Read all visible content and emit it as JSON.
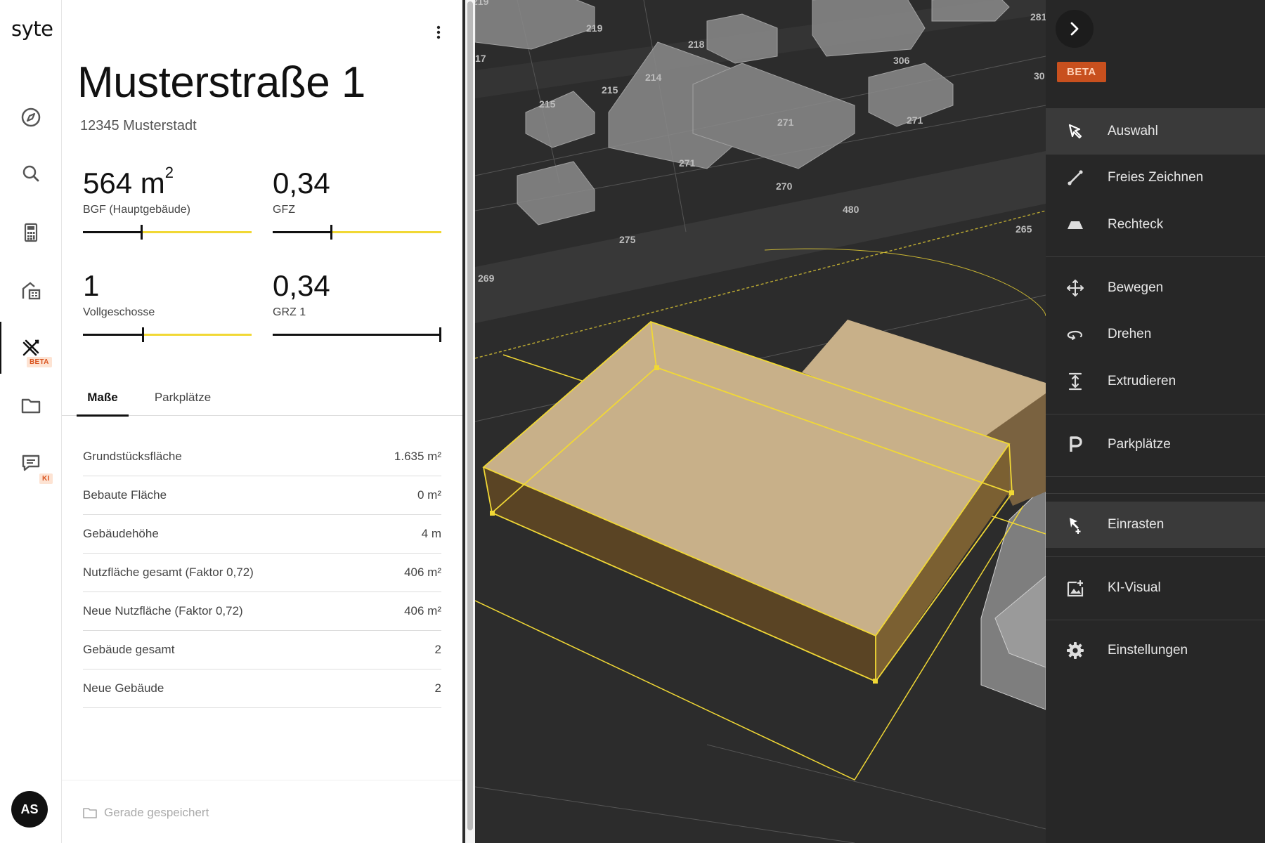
{
  "app": {
    "logo": "syte",
    "user_initials": "AS"
  },
  "rail": {
    "items": [
      {
        "name": "explore",
        "icon": "compass-icon"
      },
      {
        "name": "search",
        "icon": "search-icon"
      },
      {
        "name": "calculator",
        "icon": "calculator-icon"
      },
      {
        "name": "buildings",
        "icon": "building-icon"
      },
      {
        "name": "design",
        "icon": "drafting-tools-icon",
        "badge": "BETA",
        "active": true
      },
      {
        "name": "projects",
        "icon": "folder-icon"
      },
      {
        "name": "chat",
        "icon": "chat-icon",
        "badge": "KI"
      }
    ]
  },
  "panel": {
    "title": "Musterstraße 1",
    "subtitle": "12345 Musterstadt",
    "metrics": [
      {
        "value": "564 m",
        "unit_sup": "2",
        "label": "BGF (Hauptgebäude)",
        "slider_fraction": 0.34
      },
      {
        "value": "0,34",
        "label": "GFZ",
        "slider_fraction": 0.34
      },
      {
        "value": "1",
        "label": "Vollgeschosse",
        "slider_fraction": 0.35
      },
      {
        "value": "0,34",
        "label": "GRZ 1",
        "slider_fraction": 1.0
      }
    ],
    "tabs": [
      {
        "label": "Maße",
        "active": true
      },
      {
        "label": "Parkplätze",
        "active": false
      }
    ],
    "rows": [
      {
        "label": "Grundstücksfläche",
        "value": "1.635 m²"
      },
      {
        "label": "Bebaute Fläche",
        "value": "0 m²"
      },
      {
        "label": "Gebäudehöhe",
        "value": "4 m"
      },
      {
        "label": "Nutzfläche gesamt (Faktor 0,72)",
        "value": "406 m²"
      },
      {
        "label": "Neue Nutzfläche (Faktor 0,72)",
        "value": "406 m²"
      },
      {
        "label": "Gebäude gesamt",
        "value": "2"
      },
      {
        "label": "Neue Gebäude",
        "value": "2"
      }
    ],
    "footer_status": "Gerade gespeichert"
  },
  "map": {
    "parcel_labels": [
      "219",
      "219",
      "218",
      "214",
      "215",
      "215",
      "306",
      "281",
      "30",
      "271",
      "271",
      "271",
      "270",
      "480",
      "265",
      "275",
      "269",
      "17"
    ],
    "highlight_color": "#f1d835",
    "building_color": "#c8b089"
  },
  "tools": {
    "beta": "BETA",
    "items": [
      {
        "label": "Auswahl",
        "icon": "select-cursor-icon",
        "active": true
      },
      {
        "label": "Freies Zeichnen",
        "icon": "freehand-line-icon"
      },
      {
        "label": "Rechteck",
        "icon": "rectangle-prism-icon"
      },
      {
        "label": "Bewegen",
        "icon": "move-arrows-icon"
      },
      {
        "label": "Drehen",
        "icon": "rotate-icon"
      },
      {
        "label": "Extrudieren",
        "icon": "extrude-icon"
      },
      {
        "label": "Parkplätze",
        "icon": "parking-icon"
      },
      {
        "label": "Einrasten",
        "icon": "snap-cursor-icon",
        "active": true
      },
      {
        "label": "KI-Visual",
        "icon": "ai-image-icon"
      },
      {
        "label": "Einstellungen",
        "icon": "gear-icon"
      }
    ]
  }
}
